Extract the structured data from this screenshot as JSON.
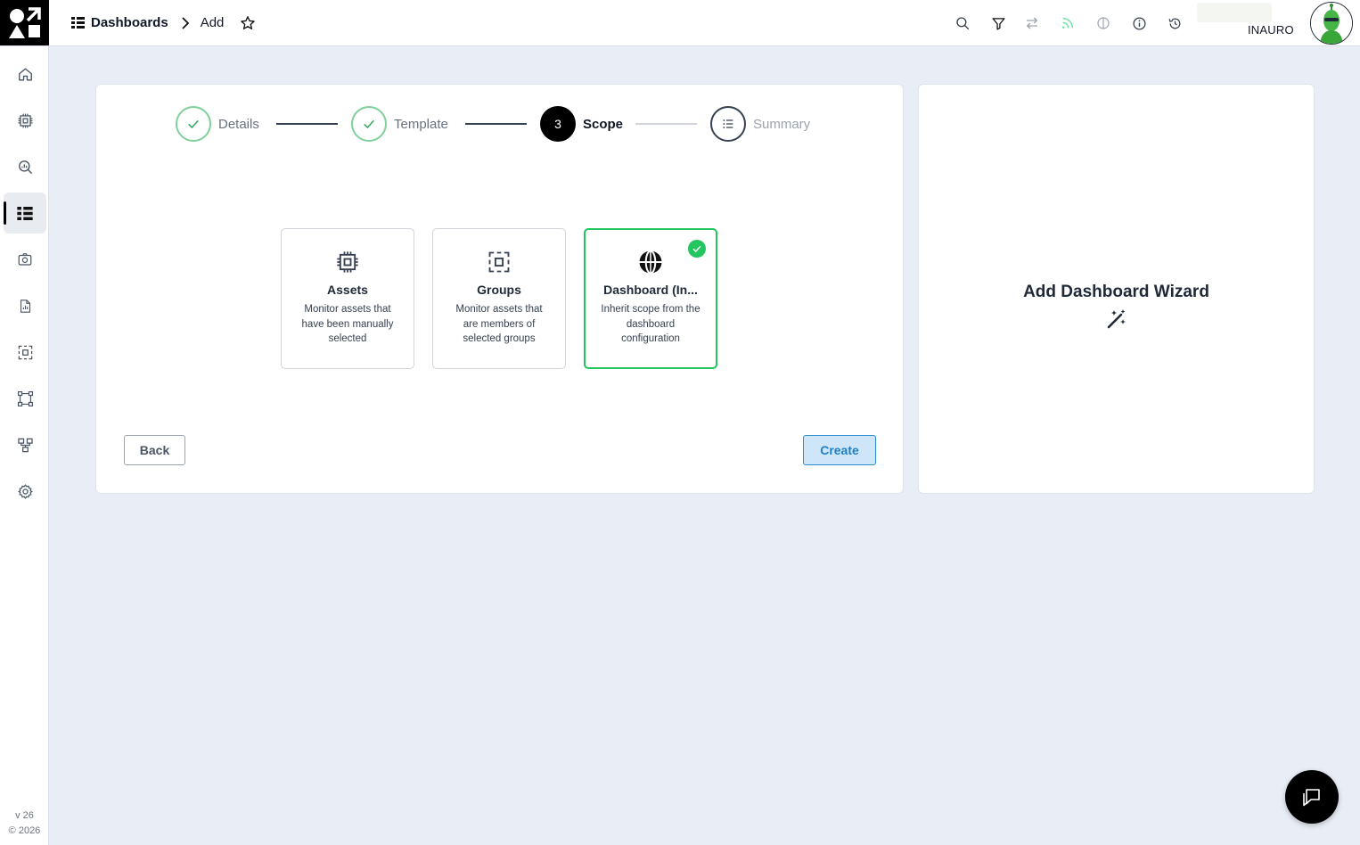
{
  "breadcrumb": {
    "root": "Dashboards",
    "current": "Add"
  },
  "user": {
    "name": "INAURO"
  },
  "toolbar": {
    "icons": [
      "search-icon",
      "filter-icon",
      "swap-icon",
      "feed-icon",
      "theme-icon",
      "info-icon",
      "history-icon"
    ]
  },
  "sidebar": {
    "items": [
      "home",
      "assets",
      "analytics",
      "dashboards",
      "snapshots",
      "reports",
      "groups",
      "zones",
      "hierarchy",
      "settings"
    ],
    "active": "dashboards",
    "version": "v 26",
    "copyright": "© 2026"
  },
  "stepper": {
    "steps": [
      {
        "label": "Details",
        "state": "done"
      },
      {
        "label": "Template",
        "state": "done"
      },
      {
        "label": "Scope",
        "number": "3",
        "state": "current"
      },
      {
        "label": "Summary",
        "state": "future"
      }
    ]
  },
  "options": [
    {
      "title": "Assets",
      "description": "Monitor assets that have been manually selected",
      "icon": "chip-icon",
      "selected": false
    },
    {
      "title": "Groups",
      "description": "Monitor assets that are members of selected groups",
      "icon": "group-select-icon",
      "selected": false
    },
    {
      "title": "Dashboard (In...",
      "description": "Inherit scope from the dashboard configuration",
      "icon": "globe-icon",
      "selected": true
    }
  ],
  "buttons": {
    "back": "Back",
    "create": "Create"
  },
  "wizard": {
    "title": "Add Dashboard Wizard",
    "icon": "magic-wand-icon"
  },
  "colors": {
    "success": "#22c55e",
    "primary": "#1f7fc4",
    "primary_bg": "#cfe6f8",
    "background": "#e9edf5"
  }
}
